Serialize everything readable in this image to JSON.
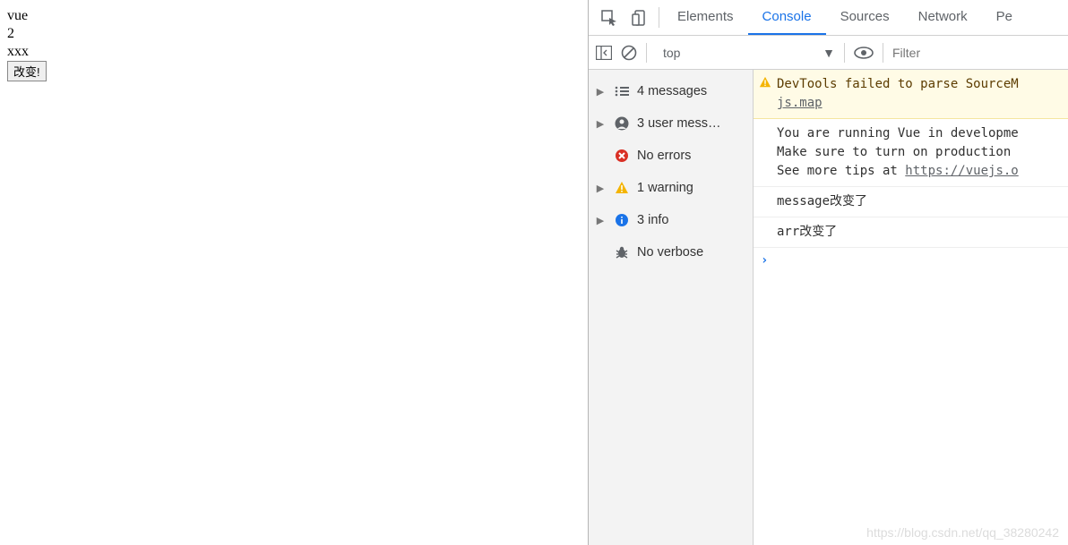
{
  "page": {
    "line1": "vue",
    "line2": "2",
    "line3": "xxx",
    "button_label": "改变!"
  },
  "devtools": {
    "tabs": {
      "elements": "Elements",
      "console": "Console",
      "sources": "Sources",
      "network": "Network",
      "perf_partial": "Pe"
    },
    "toolbar": {
      "context": "top",
      "filter_placeholder": "Filter"
    },
    "sidebar": {
      "messages": "4 messages",
      "user_messages": "3 user mess…",
      "no_errors": "No errors",
      "warnings": "1 warning",
      "info": "3 info",
      "verbose": "No verbose"
    },
    "console_messages": {
      "warn_text": "DevTools failed to parse SourceM",
      "warn_link": "js.map",
      "dev_line1": "You are running Vue in developme",
      "dev_line2": "Make sure to turn on production ",
      "dev_line3_pre": "See more tips at ",
      "dev_line3_link": "https://vuejs.o",
      "log1": "message改变了",
      "log2": "arr改变了"
    }
  },
  "watermark": "https://blog.csdn.net/qq_38280242"
}
